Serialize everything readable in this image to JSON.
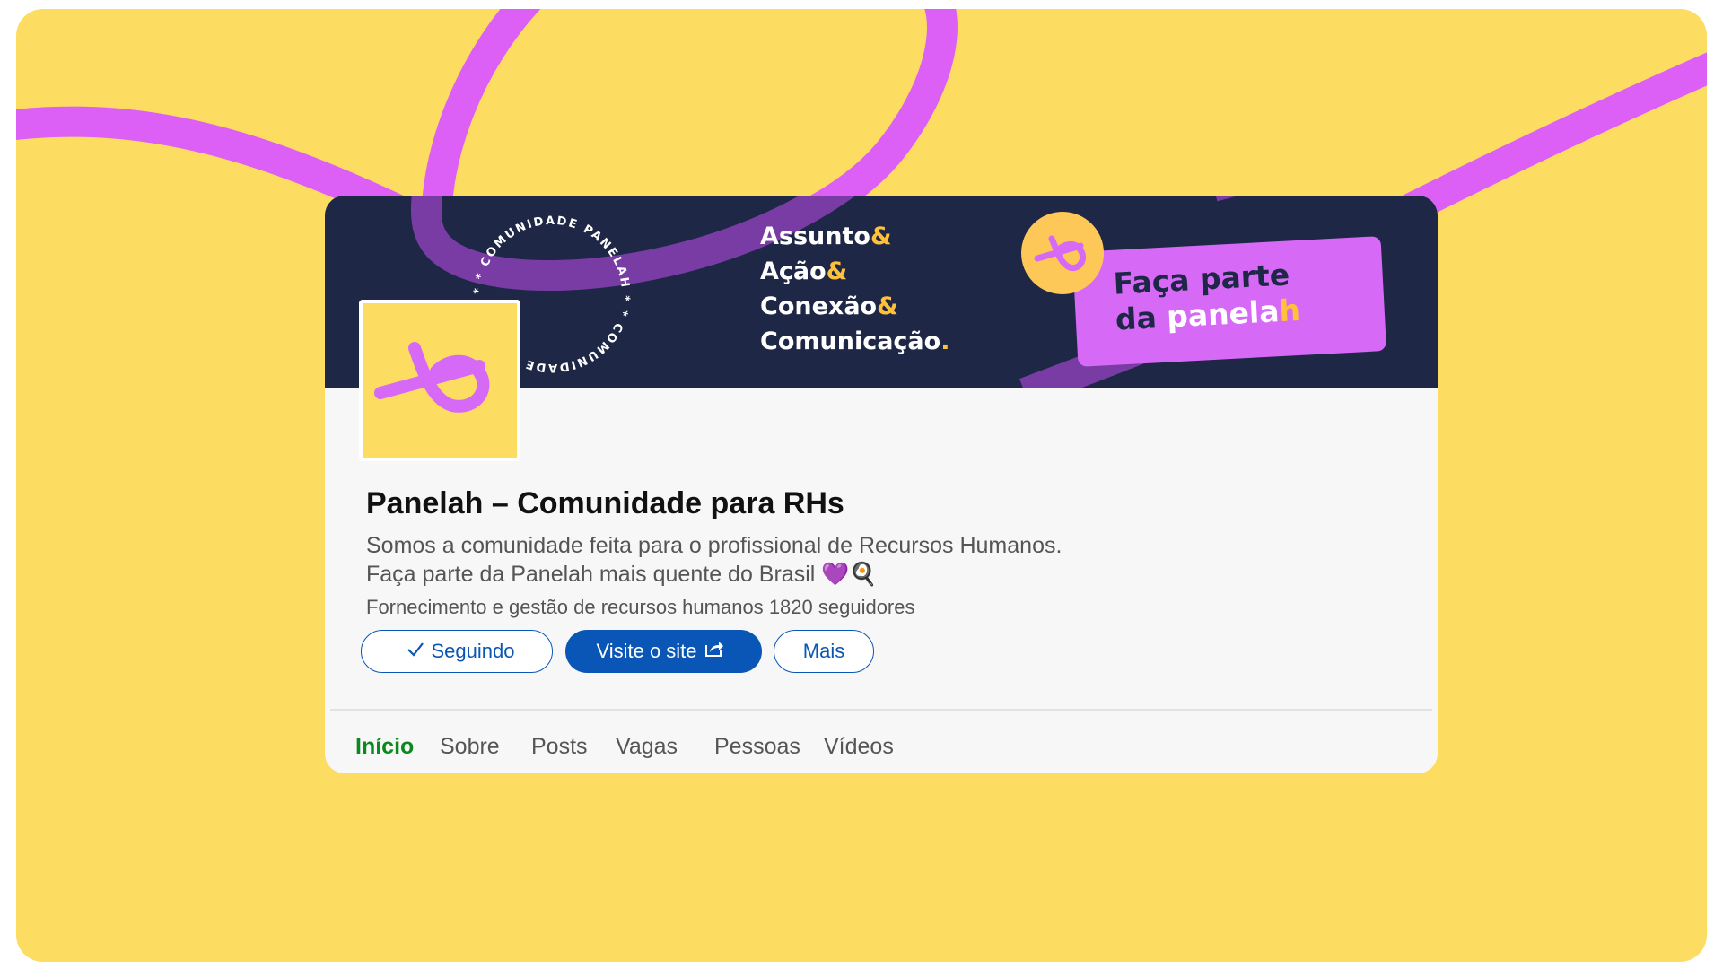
{
  "banner": {
    "ring_text": "* * COMUNIDADE PANELAH * * COMUNIDADE PANELAH",
    "tagline": [
      {
        "word": "Assunto",
        "suffix": "&"
      },
      {
        "word": "Ação",
        "suffix": "&"
      },
      {
        "word": "Conexão",
        "suffix": "&"
      },
      {
        "word": "Comunicação",
        "suffix": "."
      }
    ],
    "cta_line1": "Faça parte",
    "cta_line2_prefix": "da",
    "cta_brand": "panela",
    "cta_brand_h": "h"
  },
  "company": {
    "name": "Panelah – Comunidade para RHs",
    "description_line1": "Somos a comunidade feita para o profissional de Recursos Humanos.",
    "description_line2": "Faça parte da Panelah mais quente do Brasil 💜🍳",
    "industry": "Fornecimento e gestão de recursos humanos",
    "followers": "1820 seguidores"
  },
  "actions": {
    "following_label": "Seguindo",
    "visit_label": "Visite o site",
    "more_label": "Mais"
  },
  "tabs": [
    {
      "label": "Início",
      "active": true
    },
    {
      "label": "Sobre",
      "active": false
    },
    {
      "label": "Posts",
      "active": false
    },
    {
      "label": "Vagas",
      "active": false
    },
    {
      "label": "Pessoas",
      "active": false
    },
    {
      "label": "Vídeos",
      "active": false
    }
  ],
  "colors": {
    "background": "#fddc62",
    "ribbon": "#dc60f5",
    "banner": "#1e2745",
    "accent": "#ffc13a",
    "primary_button": "#0a56b6",
    "active_tab": "#0a8a1c"
  }
}
